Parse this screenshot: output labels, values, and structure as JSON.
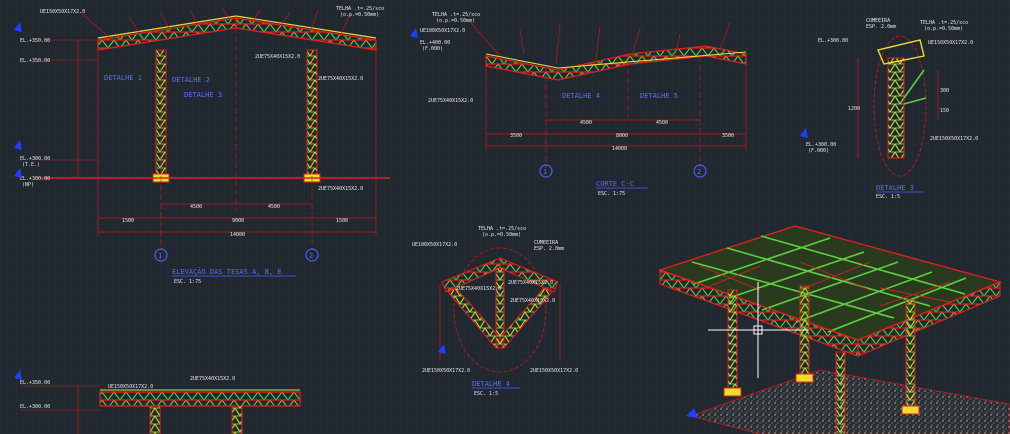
{
  "theme": {
    "background": "#212830",
    "grid": "#2b333c",
    "beam_red": "#e02020",
    "truss_green": "#5cd040",
    "truss_yellow": "#e8e030",
    "dimension_red": "#d01818",
    "label_blue": "#4b5cff",
    "label_white": "#e8e8e8",
    "ucs_blue": "#1d3fff"
  },
  "drawing_a": {
    "top_labels": [
      "UE150X50X17X2.0",
      "TELHA .t=.25/sco",
      "(o.p.=0.50mm)"
    ],
    "level_labels": [
      "EL.+350.00",
      "EL.+350.00",
      "EL.+300.00",
      "EL.+300.00"
    ],
    "level_tags": [
      "(T.E.)",
      "(NP)"
    ],
    "section_tags": [
      "DETALHE 1",
      "DETALHE 2",
      "DETALHE 3"
    ],
    "member_labels": [
      "2UE75X40X15X2.0",
      "2UE75X40X15X2.0",
      "2UE75X40X15X2.0"
    ],
    "dims": [
      "1500",
      "4500",
      "4500",
      "1500",
      "9000",
      "14000"
    ],
    "axis_markers": [
      "1",
      "2"
    ],
    "title": "ELEVAÇÃO DAS TESAS A, B, E",
    "scale": "ESC. 1:75"
  },
  "drawing_b": {
    "top_labels": [
      "TELHA .t=.25/sco",
      "(o.p.=0.50mm)",
      "UE100X50X17X2.0",
      "EL.+400.00",
      "(F.000)"
    ],
    "member_labels": [
      "2UE75X40X15X2.0"
    ],
    "section_tags": [
      "DETALHE 4",
      "DETALHE 5"
    ],
    "dims": [
      "4500",
      "4500",
      "3500",
      "3500",
      "8000",
      "14000"
    ],
    "axis_markers": [
      "1",
      "2"
    ],
    "title": "CORTE C-C",
    "scale": "ESC. 1:75"
  },
  "drawing_c": {
    "labels": [
      "CUMEEIRA",
      "ESP. 2.0mm",
      "TELHA .t=.25/sco",
      "(o.p.=0.50mm)",
      "EL.+300.00",
      "UE150X50X17X2.0",
      "EL.+300.00",
      "(F.000)",
      "2UE150X50X17X2.0"
    ],
    "dims": [
      "1200",
      "300",
      "150"
    ],
    "title": "DETALHE 3",
    "scale": "ESC. 1:5"
  },
  "drawing_d": {
    "labels": [
      "TELHA .t=.25/sco",
      "(o.p.=0.50mm)",
      "CUMEEIRA",
      "ESP. 2.0mm",
      "UE100X50X17X2.0",
      "2UE75X40X15X2.0",
      "2UE75X40X15X2.0",
      "2UE75X40X15X2.0",
      "2UE150X50X17X2.0",
      "2UE150X50X17X2.0"
    ],
    "title": "DETALHE 4",
    "scale": "ESC. 1:5"
  },
  "drawing_e": {
    "level_labels": [
      "EL.+350.00",
      "EL.+300.00"
    ],
    "member_labels": [
      "UE150X50X17X2.0",
      "2UE75X40X15X2.0"
    ]
  },
  "isometric": {
    "description_tag": "3D truss roof structure"
  },
  "crosshair": {
    "visible": true
  }
}
